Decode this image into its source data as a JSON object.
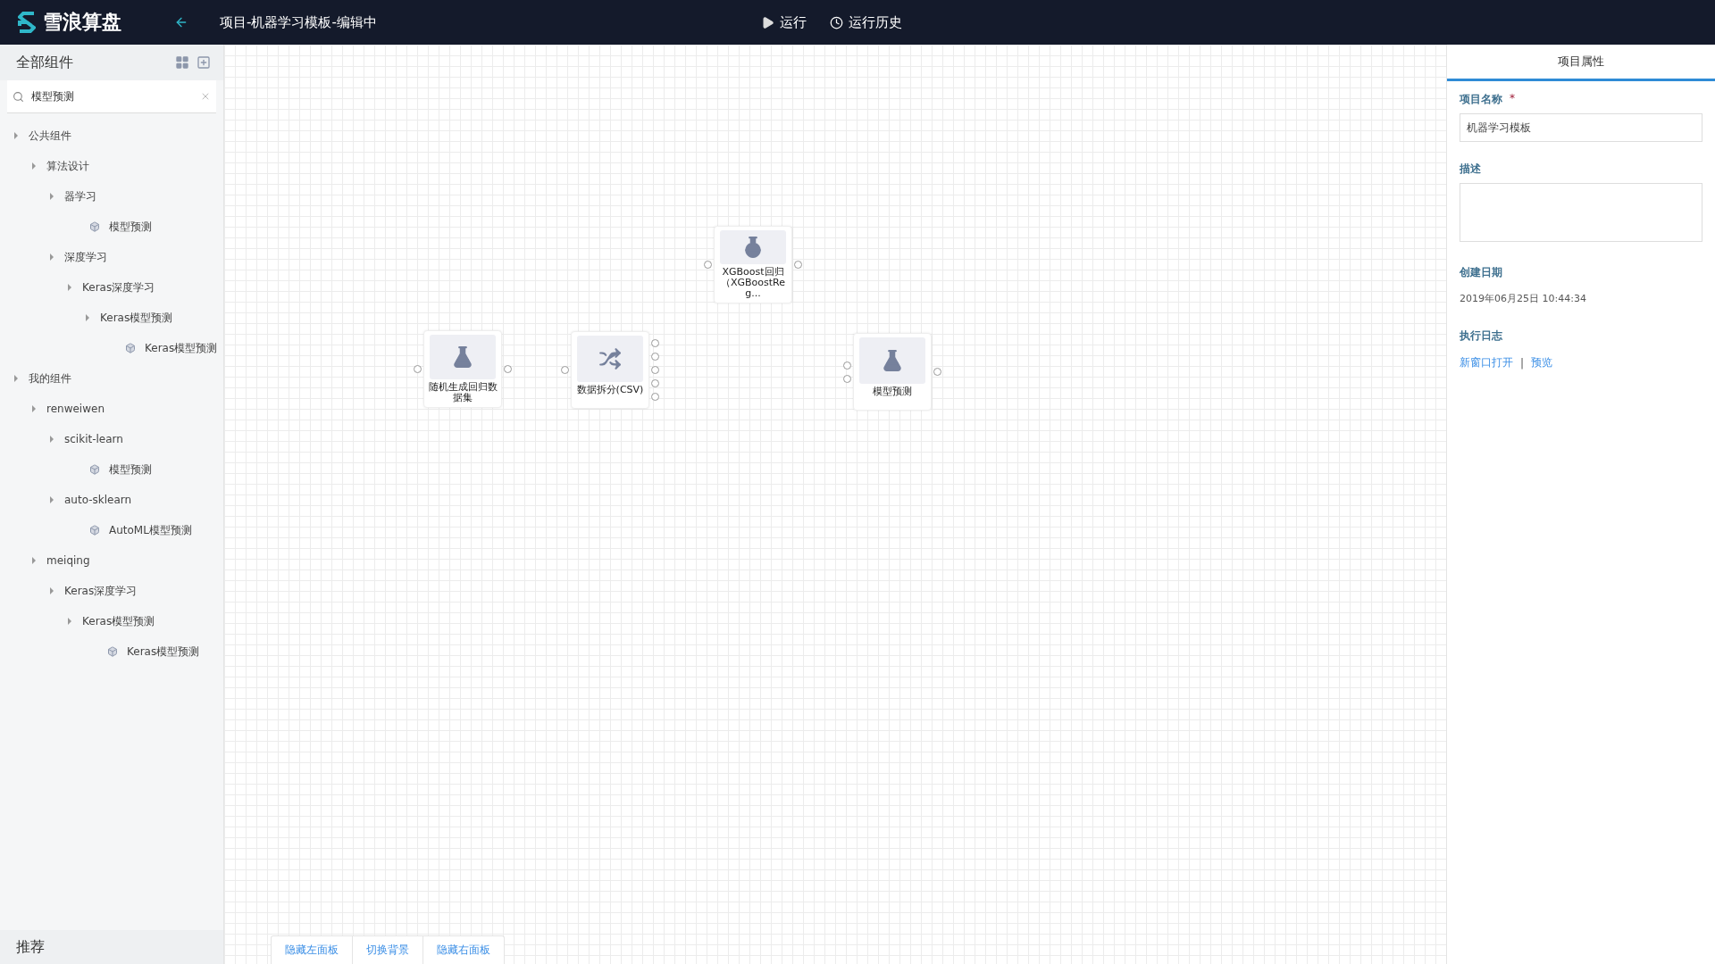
{
  "header": {
    "logo": "雪浪算盘",
    "title": "项目-机器学习模板-编辑中",
    "actions": [
      {
        "kind": "run",
        "label": "运行"
      },
      {
        "kind": "history",
        "label": "运行历史"
      }
    ]
  },
  "sidebar": {
    "title": "全部组件",
    "search": {
      "value": "模型预测"
    },
    "tree": [
      {
        "label": "公共组件",
        "kind": "folder",
        "children": [
          {
            "label": "算法设计",
            "kind": "folder",
            "children": [
              {
                "label": "器学习",
                "kind": "folder",
                "children": [
                  {
                    "label": "模型预测",
                    "kind": "leaf"
                  }
                ]
              },
              {
                "label": "深度学习",
                "kind": "folder",
                "children": [
                  {
                    "label": "Keras深度学习",
                    "kind": "folder",
                    "children": [
                      {
                        "label": "Keras模型预测",
                        "kind": "folder",
                        "children": [
                          {
                            "label": "Keras模型预测",
                            "kind": "leaf"
                          }
                        ]
                      }
                    ]
                  }
                ]
              }
            ]
          }
        ]
      },
      {
        "label": "我的组件",
        "kind": "folder",
        "children": [
          {
            "label": "renweiwen",
            "kind": "folder",
            "children": [
              {
                "label": "scikit-learn",
                "kind": "folder",
                "children": [
                  {
                    "label": "模型预测",
                    "kind": "leaf"
                  }
                ]
              },
              {
                "label": "auto-sklearn",
                "kind": "folder",
                "children": [
                  {
                    "label": "AutoML模型预测",
                    "kind": "leaf"
                  }
                ]
              }
            ]
          },
          {
            "label": "meiqing",
            "kind": "folder",
            "children": [
              {
                "label": "Keras深度学习",
                "kind": "folder",
                "children": [
                  {
                    "label": "Keras模型预测",
                    "kind": "folder",
                    "children": [
                      {
                        "label": "Keras模型预测",
                        "kind": "leaf"
                      }
                    ]
                  }
                ]
              }
            ]
          }
        ]
      }
    ],
    "footer": "推荐"
  },
  "canvas": {
    "nodes": [
      {
        "label": "XGBoost回归（XGBoostReg...",
        "kind": "flask-round",
        "inputs": [
          {
            "kind": "port"
          }
        ],
        "outputs": [
          {
            "kind": "port"
          }
        ]
      },
      {
        "label": "随机生成回归数据集",
        "kind": "flask",
        "inputs": [
          {
            "kind": "port"
          }
        ],
        "outputs": [
          {
            "kind": "port"
          }
        ]
      },
      {
        "label": "数据拆分(CSV)",
        "kind": "shuffle",
        "inputs": [
          {
            "kind": "port"
          }
        ],
        "outputs": [
          {
            "kind": "port"
          },
          {
            "kind": "port"
          },
          {
            "kind": "port"
          },
          {
            "kind": "port"
          },
          {
            "kind": "port"
          }
        ]
      },
      {
        "label": "模型预测",
        "kind": "flask",
        "inputs": [
          {
            "kind": "port"
          },
          {
            "kind": "port"
          }
        ],
        "outputs": [
          {
            "kind": "port"
          }
        ]
      }
    ],
    "toolbar": [
      "隐藏左面板",
      "切换背景",
      "隐藏右面板"
    ]
  },
  "properties": {
    "tab": "项目属性",
    "name_label": "项目名称",
    "required_mark": "*",
    "name_value": "机器学习模板",
    "description_label": "描述",
    "created_label": "创建日期",
    "created_value": "2019年06月25日 10:44:34",
    "log_label": "执行日志",
    "log_links": [
      "新窗口打开",
      "预览"
    ],
    "separator": "|"
  }
}
